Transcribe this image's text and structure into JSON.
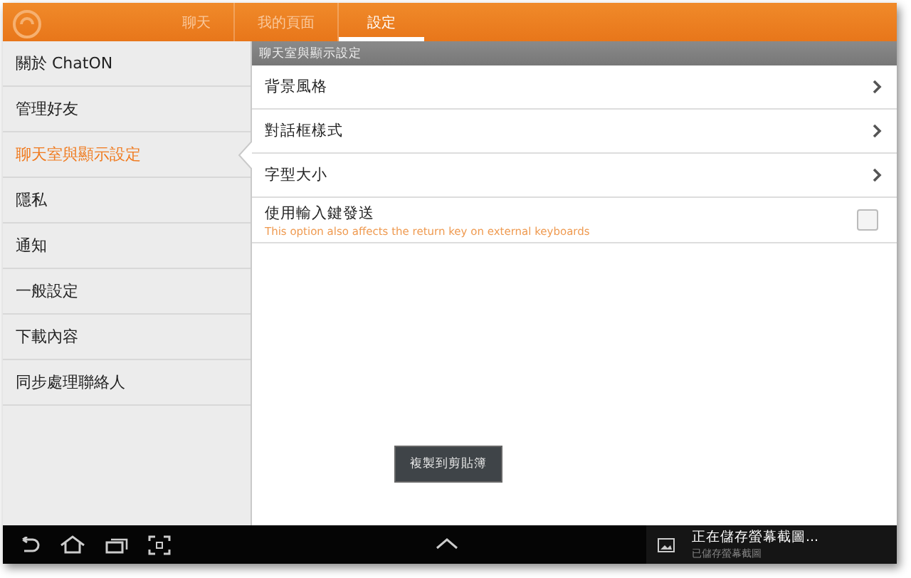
{
  "tabs": [
    {
      "label": "聊天",
      "selected": false
    },
    {
      "label": "我的頁面",
      "selected": false
    },
    {
      "label": "設定",
      "selected": true
    }
  ],
  "sidebar": {
    "items": [
      {
        "label": "關於 ChatON",
        "selected": false
      },
      {
        "label": "管理好友",
        "selected": false
      },
      {
        "label": "聊天室與顯示設定",
        "selected": true
      },
      {
        "label": "隱私",
        "selected": false
      },
      {
        "label": "通知",
        "selected": false
      },
      {
        "label": "一般設定",
        "selected": false
      },
      {
        "label": "下載內容",
        "selected": false
      },
      {
        "label": "同步處理聯絡人",
        "selected": false
      }
    ]
  },
  "panel": {
    "header": "聊天室與顯示設定",
    "rows": [
      {
        "kind": "link",
        "label": "背景風格"
      },
      {
        "kind": "link",
        "label": "對話框樣式"
      },
      {
        "kind": "link",
        "label": "字型大小"
      },
      {
        "kind": "checkbox",
        "label": "使用輸入鍵發送",
        "hint": "This option also affects the return key on external keyboards",
        "checked": false
      }
    ]
  },
  "toast": "複製到剪貼簿",
  "notification": {
    "title": "正在儲存螢幕截圖...",
    "subtitle": "已儲存螢幕截圖"
  }
}
